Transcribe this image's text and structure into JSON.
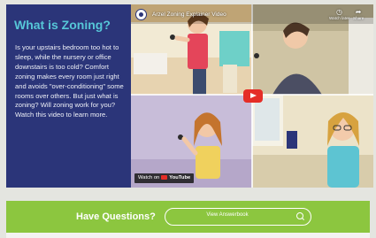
{
  "sidebar": {
    "title": "What is Zoning?",
    "body": "Is your upstairs bedroom too hot to sleep, while the nursery or office downstairs is too cold? Comfort zoning makes every room just right and avoids \"over-conditioning\" some rooms over others. But just what is zoning? Will zoning work for you? Watch this video to learn more."
  },
  "video": {
    "title": "Arzel Zoning Explainer Video",
    "watch_later_label": "Watch later",
    "share_label": "Share",
    "watch_on_label": "Watch on",
    "youtube_label": "YouTube"
  },
  "questions": {
    "heading": "Have Questions?",
    "button_label": "View Answerbook"
  },
  "colors": {
    "panel_blue": "#2b3579",
    "title_cyan": "#56c7d8",
    "band_green": "#8cc63f",
    "play_red": "#e52d27"
  },
  "icons": [
    "arzel-logo-icon",
    "clock-icon",
    "share-icon",
    "play-icon",
    "youtube-icon",
    "search-icon"
  ]
}
